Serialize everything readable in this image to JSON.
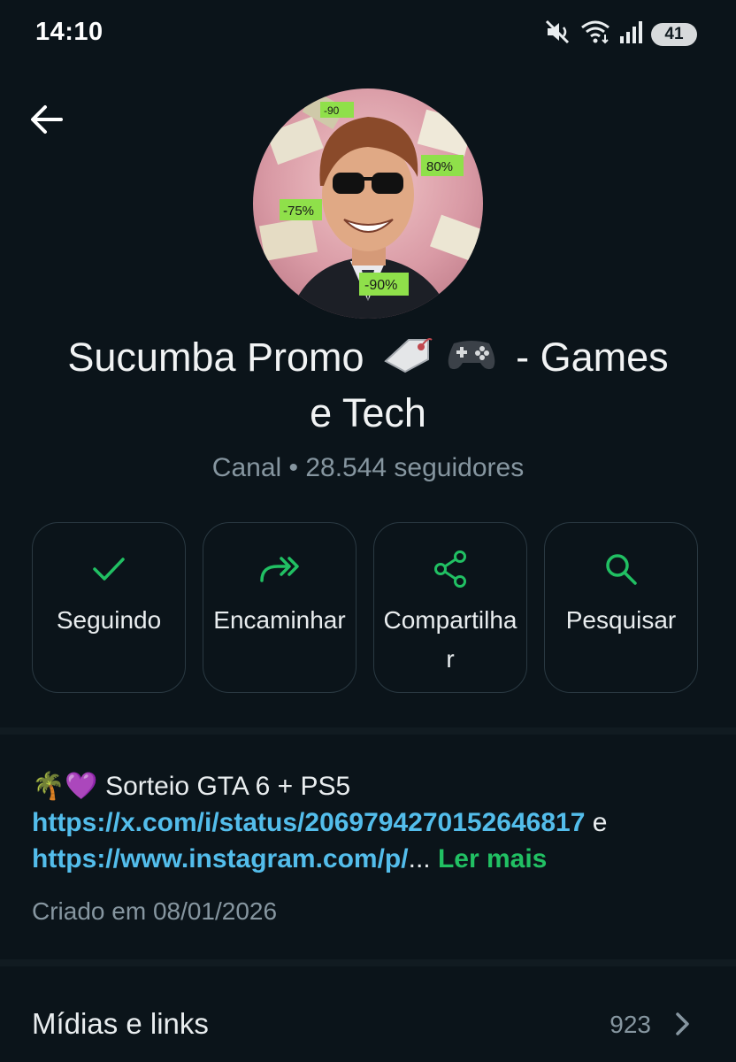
{
  "status_bar": {
    "time": "14:10",
    "battery": "41",
    "icons": [
      "mute-icon",
      "wifi-icon",
      "signal-icon",
      "battery-icon"
    ]
  },
  "header": {
    "back_icon": "back-arrow-icon"
  },
  "channel": {
    "title_part1": "Sucumba Promo",
    "title_part2": "- Games",
    "title_part3": "e Tech",
    "title_icons": [
      "tag-icon",
      "gamepad-icon"
    ],
    "subtitle": "Canal • 28.544 seguidores"
  },
  "avatar": {
    "badges": [
      "-75%",
      "80%",
      "-90%",
      "-90"
    ]
  },
  "actions": [
    {
      "label": "Seguindo",
      "icon": "check-icon"
    },
    {
      "label": "Encaminhar",
      "icon": "forward-icon"
    },
    {
      "label": "Compartilhar",
      "icon": "share-icon"
    },
    {
      "label": "Pesquisar",
      "icon": "search-icon"
    }
  ],
  "description": {
    "emoji": "🌴💜",
    "text": "Sorteio GTA 6 + PS5",
    "link1": "https://x.com/i/status/2069794270152646817",
    "connector": "e",
    "link2": "https://www.instagram.com/p/",
    "ellipsis": "...",
    "read_more": "Ler mais"
  },
  "created": "Criado em 08/01/2026",
  "media": {
    "label": "Mídias e links",
    "count": "923"
  },
  "colors": {
    "background": "#0b141a",
    "accent_green": "#21c063",
    "link_blue": "#53bdeb",
    "muted_text": "#8696a0"
  }
}
